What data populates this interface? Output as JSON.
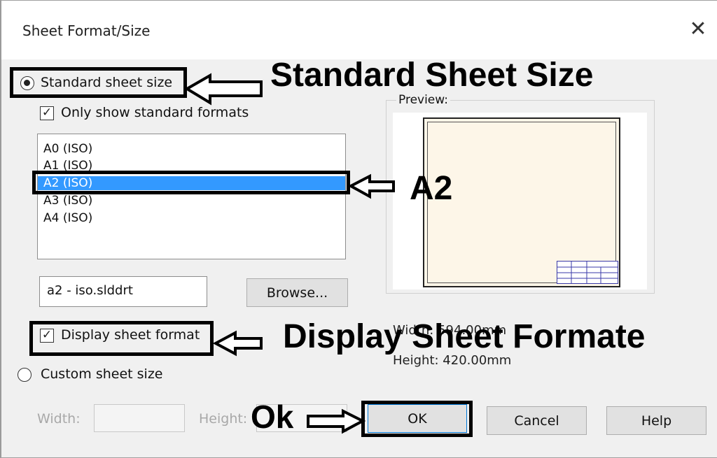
{
  "window": {
    "title": "Sheet Format/Size",
    "close_glyph": "✕"
  },
  "standard": {
    "label": "Standard sheet size",
    "only_standard_label": "Only show standard formats",
    "list": [
      "A0 (ISO)",
      "A1 (ISO)",
      "A2 (ISO)",
      "A3 (ISO)",
      "A4 (ISO)"
    ],
    "selected_index": 2,
    "format_file": "a2 - iso.slddrt",
    "browse_label": "Browse..."
  },
  "preview": {
    "label": "Preview:",
    "width_text": "Width:  594.00mm",
    "height_text": "Height:  420.00mm"
  },
  "display_format": {
    "label": "Display sheet format",
    "checked": true
  },
  "custom": {
    "label": "Custom sheet size",
    "width_label": "Width:",
    "height_label": "Height:"
  },
  "buttons": {
    "ok": "OK",
    "cancel": "Cancel",
    "help": "Help"
  },
  "annotations": {
    "standard": "Standard Sheet Size",
    "a2": "A2",
    "display": "Display Sheet Formate",
    "ok": "Ok"
  },
  "colors": {
    "selection": "#3399ff",
    "sheet": "#fdf6e8",
    "highlight": "#000000"
  }
}
